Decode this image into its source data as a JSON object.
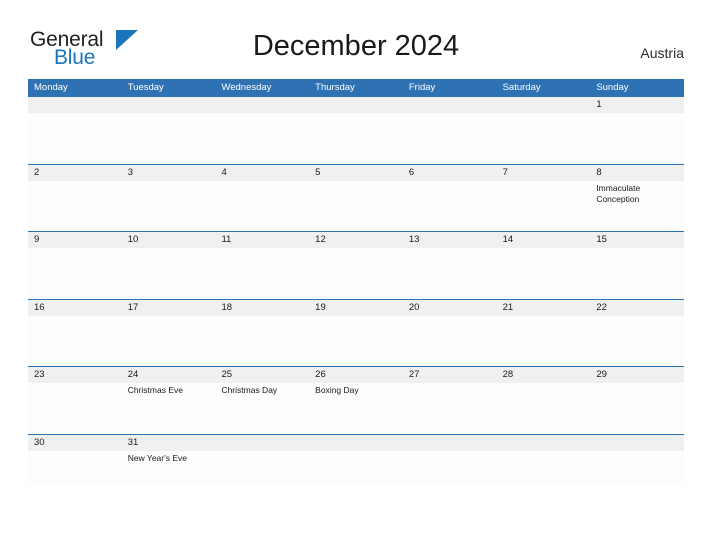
{
  "brand": {
    "name_part1": "General",
    "name_part2": "Blue",
    "accent_color": "#1b75bb"
  },
  "header": {
    "title": "December 2024",
    "country": "Austria",
    "header_bar_color": "#2e72b4"
  },
  "weekdays": [
    "Monday",
    "Tuesday",
    "Wednesday",
    "Thursday",
    "Friday",
    "Saturday",
    "Sunday"
  ],
  "weeks": [
    {
      "days": [
        {
          "number": "",
          "event": ""
        },
        {
          "number": "",
          "event": ""
        },
        {
          "number": "",
          "event": ""
        },
        {
          "number": "",
          "event": ""
        },
        {
          "number": "",
          "event": ""
        },
        {
          "number": "",
          "event": ""
        },
        {
          "number": "1",
          "event": ""
        }
      ]
    },
    {
      "days": [
        {
          "number": "2",
          "event": ""
        },
        {
          "number": "3",
          "event": ""
        },
        {
          "number": "4",
          "event": ""
        },
        {
          "number": "5",
          "event": ""
        },
        {
          "number": "6",
          "event": ""
        },
        {
          "number": "7",
          "event": ""
        },
        {
          "number": "8",
          "event": "Immaculate Conception"
        }
      ]
    },
    {
      "days": [
        {
          "number": "9",
          "event": ""
        },
        {
          "number": "10",
          "event": ""
        },
        {
          "number": "11",
          "event": ""
        },
        {
          "number": "12",
          "event": ""
        },
        {
          "number": "13",
          "event": ""
        },
        {
          "number": "14",
          "event": ""
        },
        {
          "number": "15",
          "event": ""
        }
      ]
    },
    {
      "days": [
        {
          "number": "16",
          "event": ""
        },
        {
          "number": "17",
          "event": ""
        },
        {
          "number": "18",
          "event": ""
        },
        {
          "number": "19",
          "event": ""
        },
        {
          "number": "20",
          "event": ""
        },
        {
          "number": "21",
          "event": ""
        },
        {
          "number": "22",
          "event": ""
        }
      ]
    },
    {
      "days": [
        {
          "number": "23",
          "event": ""
        },
        {
          "number": "24",
          "event": "Christmas Eve"
        },
        {
          "number": "25",
          "event": "Christmas Day"
        },
        {
          "number": "26",
          "event": "Boxing Day"
        },
        {
          "number": "27",
          "event": ""
        },
        {
          "number": "28",
          "event": ""
        },
        {
          "number": "29",
          "event": ""
        }
      ]
    },
    {
      "days": [
        {
          "number": "30",
          "event": ""
        },
        {
          "number": "31",
          "event": "New Year's Eve"
        },
        {
          "number": "",
          "event": ""
        },
        {
          "number": "",
          "event": ""
        },
        {
          "number": "",
          "event": ""
        },
        {
          "number": "",
          "event": ""
        },
        {
          "number": "",
          "event": ""
        }
      ]
    }
  ]
}
